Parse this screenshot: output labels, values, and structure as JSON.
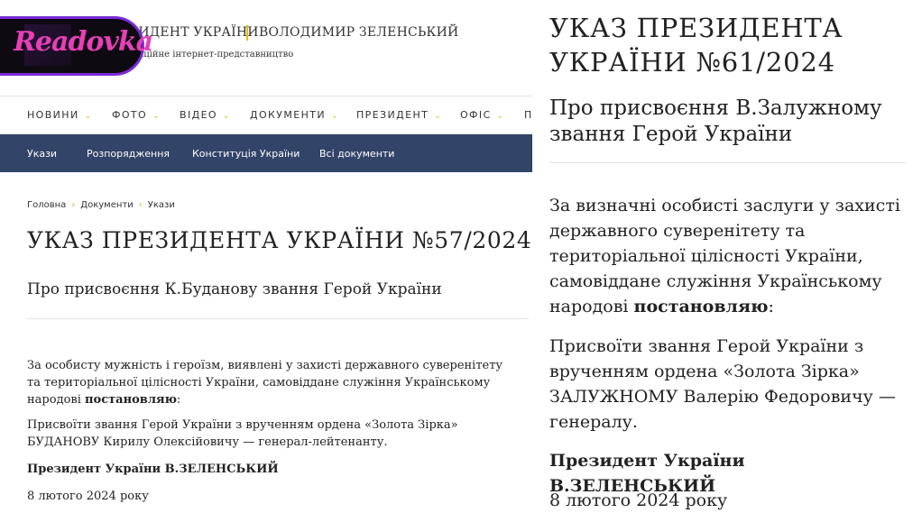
{
  "logo": {
    "text": "Readovka"
  },
  "header": {
    "site_name": "ПРЕЗИДЕНТ УКРАЇНИ",
    "person": "ВОЛОДИМИР ЗЕЛЕНСЬКИЙ",
    "subtitle": "Офіційне інтернет-представництво",
    "accent_color": "#e6b800"
  },
  "topnav": {
    "items": [
      {
        "label": "НОВИНИ",
        "icon": "chevron-down-icon"
      },
      {
        "label": "ФОТО",
        "icon": "chevron-down-icon"
      },
      {
        "label": "ВІДЕО",
        "icon": "chevron-down-icon"
      },
      {
        "label": "ДОКУМЕНТИ",
        "icon": "chevron-down-icon"
      },
      {
        "label": "ПРЕЗИДЕНТ",
        "icon": "chevron-down-icon"
      },
      {
        "label": "ОФІС",
        "icon": "chevron-down-icon"
      },
      {
        "label": "П"
      }
    ]
  },
  "subnav": {
    "color": "#324468",
    "items": [
      {
        "label": "Укази"
      },
      {
        "label": "Розпорядження"
      },
      {
        "label": "Конституція України"
      },
      {
        "label": "Всі документи"
      }
    ]
  },
  "breadcrumb": {
    "items": [
      "Головна",
      "Документи",
      "Укази"
    ]
  },
  "left_doc": {
    "title": "УКАЗ ПРЕЗИДЕНТА УКРАЇНИ №57/2024",
    "subtitle": "Про присвоєння К.Буданову звання Герой України",
    "para1_text": "За особисту мужність і героїзм, виявлені у захисті державного суверенітету та територіальної цілісності України, самовіддане служіння Українському народові ",
    "para1_bold": "постановляю",
    "para1_end": ":",
    "para2": "Присвоїти звання Герой України з врученням ордена «Золота Зірка» БУДАНОВУ Кирилу Олексійовичу — генерал-лейтенанту.",
    "signature": "Президент України В.ЗЕЛЕНСЬКИЙ",
    "date": "8 лютого 2024 року"
  },
  "right_doc": {
    "title": "УКАЗ ПРЕЗИДЕНТА УКРАЇНИ №61/2024",
    "subtitle": "Про присвоєння В.Залужному звання Герой України",
    "para1_text": "За визначні особисті заслуги у захисті державного суверенітету та територіальної цілісності України, самовіддане служіння Українському народові ",
    "para1_bold": "постановляю",
    "para1_end": ":",
    "para2": "Присвоїти звання Герой України з врученням ордена «Золота Зірка» ЗАЛУЖНОМУ Валерію Федоровичу — генералу.",
    "signature": "Президент України В.ЗЕЛЕНСЬКИЙ",
    "date": "8 лютого 2024 року"
  }
}
